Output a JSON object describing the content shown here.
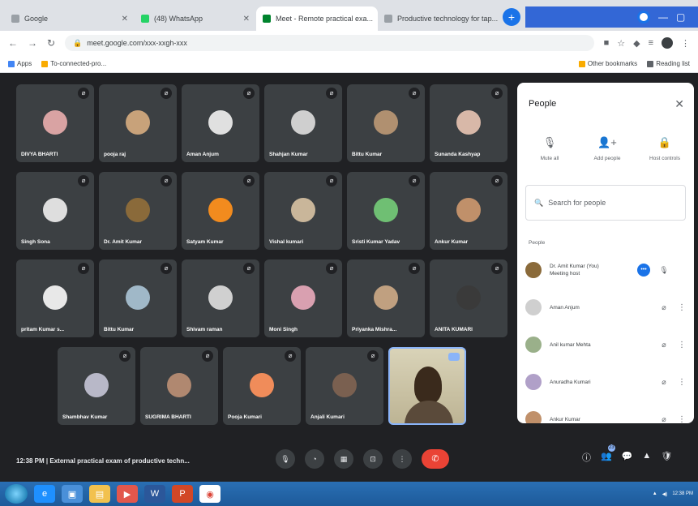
{
  "browser": {
    "tabs": [
      {
        "title": "Google",
        "active": false
      },
      {
        "title": "(48) WhatsApp",
        "active": false
      },
      {
        "title": "Meet - Remote practical exa...",
        "active": true,
        "recording": true
      },
      {
        "title": "Productive technology for tap...",
        "active": false
      }
    ],
    "new_tab": "+",
    "url": "meet.google.com/xxx-xxgh-xxx",
    "bookmarks": [
      "Apps",
      "To-connected-pro..."
    ],
    "bookmarks_right": [
      "Other bookmarks",
      "Reading list"
    ]
  },
  "participants": [
    {
      "name": "DIVYA BHARTI",
      "color": "#d9a3a3"
    },
    {
      "name": "pooja raj",
      "color": "#c8a27a"
    },
    {
      "name": "Aman Anjum",
      "color": "#e0e0e0"
    },
    {
      "name": "Shahjan Kumar",
      "color": "#cfcfcf"
    },
    {
      "name": "Bittu Kumar",
      "color": "#b09070"
    },
    {
      "name": "Sunanda Kashyap",
      "color": "#d8b8a8"
    },
    {
      "name": "Singh Sona",
      "color": "#dedede"
    },
    {
      "name": "Dr. Amit Kumar",
      "color": "#8a6a3a"
    },
    {
      "name": "Satyam Kumar",
      "color": "#f28b1e"
    },
    {
      "name": "Vishal kumari",
      "color": "#c9b69a"
    },
    {
      "name": "Sristi Kumar Yadav",
      "color": "#6fbf73"
    },
    {
      "name": "Ankur Kumar",
      "color": "#c0906a"
    },
    {
      "name": "pritam Kumar s...",
      "color": "#e8e8e8"
    },
    {
      "name": "Bittu Kumar",
      "color": "#a0b8c8"
    },
    {
      "name": "Shivam raman",
      "color": "#d0d0d0"
    },
    {
      "name": "Moni Singh",
      "color": "#d9a0b0"
    },
    {
      "name": "Priyanka Mishra...",
      "color": "#c0a080"
    },
    {
      "name": "ANITA KUMARI",
      "color": "#3a3a3a"
    },
    {
      "name": "Shambhav Kumar",
      "color": "#b8b8c8"
    },
    {
      "name": "SUGRIMA BHARTI",
      "color": "#b08870"
    },
    {
      "name": "Pooja Kumari",
      "color": "#f08c5a"
    },
    {
      "name": "Anjali Kumari",
      "color": "#7a6050"
    }
  ],
  "self_tile": {
    "label": ""
  },
  "people_panel": {
    "title": "People",
    "close": "✕",
    "actions": [
      {
        "label": "Mute all",
        "icon": "🎙"
      },
      {
        "label": "Add people",
        "icon": "👤+"
      },
      {
        "label": "Host controls",
        "icon": "🔒"
      }
    ],
    "search_placeholder": "Search for people",
    "section_label": "People",
    "rows": [
      {
        "name": "Dr. Amit Kumar (You)\nMeeting host",
        "color": "#8a6a3a",
        "speaking": true
      },
      {
        "name": "Aman Anjum",
        "color": "#cfcfcf",
        "speaking": false
      },
      {
        "name": "Anil kumar Mehta",
        "color": "#9ab08a",
        "speaking": false
      },
      {
        "name": "Anuradha Kumari",
        "color": "#b0a0c8",
        "speaking": false
      },
      {
        "name": "Ankur Kumar",
        "color": "#c0906a",
        "speaking": false
      }
    ]
  },
  "meeting": {
    "info": "12:38 PM  |  External practical exam of productive techn..."
  },
  "controls": {
    "center": [
      "mic",
      "cc",
      "present",
      "raise",
      "more"
    ],
    "center_glyphs": [
      "🎙",
      "◔",
      "▦",
      "⊡",
      "⋮"
    ],
    "end_label": "✆",
    "right_glyphs": [
      "ⓘ",
      "👥",
      "💬",
      "▲",
      "🛡"
    ],
    "participant_count": "23"
  },
  "taskbar": {
    "icons": [
      "start",
      "ie",
      "explorer",
      "folder",
      "media",
      "word",
      "powerpoint",
      "chrome"
    ],
    "glyphs": [
      "",
      "e",
      "▣",
      "▤",
      "▶",
      "W",
      "P",
      "◉"
    ],
    "tray_time": "12:38 PM"
  }
}
